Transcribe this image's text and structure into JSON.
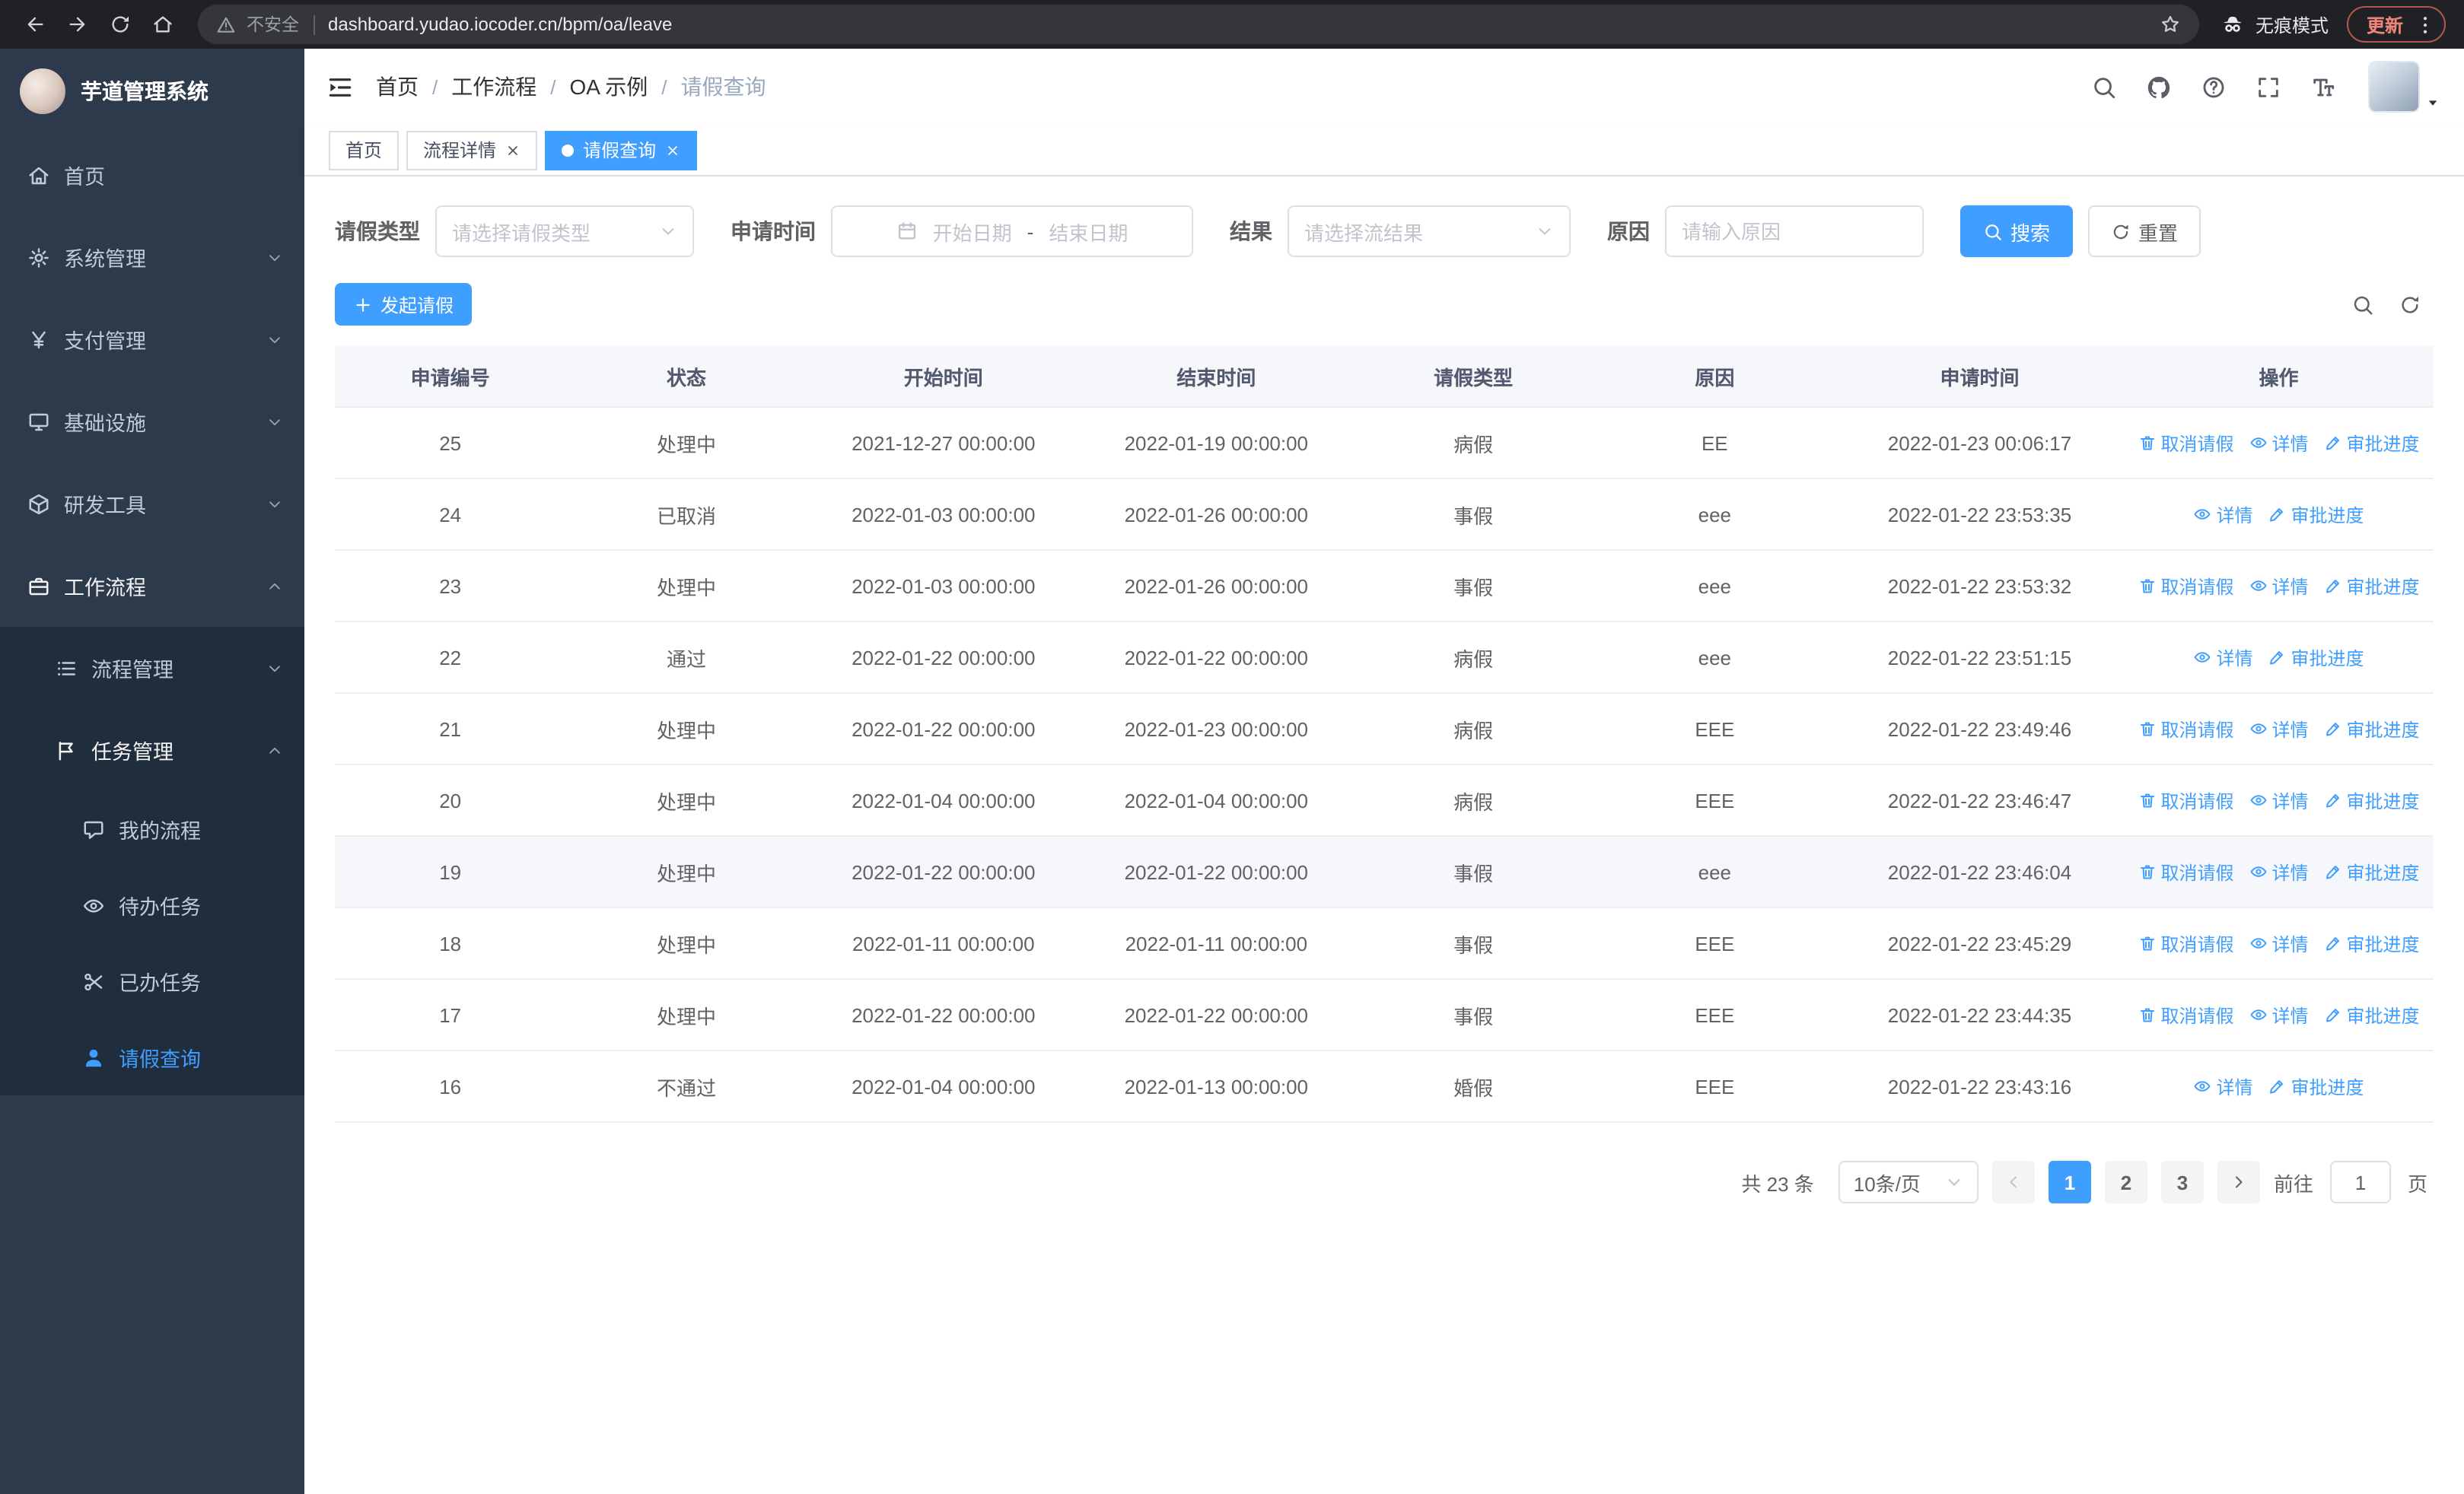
{
  "browser": {
    "security_warning": "不安全",
    "url": "dashboard.yudao.iocoder.cn/bpm/oa/leave",
    "incognito_label": "无痕模式",
    "update_button": "更新"
  },
  "sidebar": {
    "logo_title": "芋道管理系统",
    "items": [
      {
        "name": "home",
        "label": "首页",
        "icon": "home",
        "level": 1
      },
      {
        "name": "system",
        "label": "系统管理",
        "icon": "gear",
        "level": 1,
        "chevron": "down"
      },
      {
        "name": "payment",
        "label": "支付管理",
        "icon": "yen",
        "level": 1,
        "chevron": "down"
      },
      {
        "name": "infrastructure",
        "label": "基础设施",
        "icon": "infra",
        "level": 1,
        "chevron": "down"
      },
      {
        "name": "dev-tools",
        "label": "研发工具",
        "icon": "tools",
        "level": 1,
        "chevron": "down"
      },
      {
        "name": "workflow",
        "label": "工作流程",
        "icon": "workflow",
        "level": 1,
        "chevron": "up"
      },
      {
        "name": "process-mgmt",
        "label": "流程管理",
        "icon": "list",
        "level": 2,
        "chevron": "down"
      },
      {
        "name": "task-mgmt",
        "label": "任务管理",
        "icon": "task",
        "level": 2,
        "chevron": "up"
      },
      {
        "name": "my-process",
        "label": "我的流程",
        "icon": "chat",
        "level": 3
      },
      {
        "name": "todo-task",
        "label": "待办任务",
        "icon": "eye",
        "level": 3
      },
      {
        "name": "done-task",
        "label": "已办任务",
        "icon": "done",
        "level": 3
      },
      {
        "name": "leave-query",
        "label": "请假查询",
        "icon": "user",
        "level": 3,
        "active": true
      }
    ]
  },
  "header": {
    "breadcrumbs": [
      "首页",
      "工作流程",
      "OA 示例",
      "请假查询"
    ]
  },
  "tabs": [
    {
      "name": "home",
      "label": "首页",
      "closable": false,
      "active": false
    },
    {
      "name": "process-detail",
      "label": "流程详情",
      "closable": true,
      "active": false
    },
    {
      "name": "leave-query",
      "label": "请假查询",
      "closable": true,
      "active": true
    }
  ],
  "filters": {
    "leave_type": {
      "label": "请假类型",
      "placeholder": "请选择请假类型"
    },
    "apply_time": {
      "label": "申请时间",
      "start_placeholder": "开始日期",
      "separator": "-",
      "end_placeholder": "结束日期"
    },
    "result": {
      "label": "结果",
      "placeholder": "请选择流结果"
    },
    "reason": {
      "label": "原因",
      "placeholder": "请输入原因"
    },
    "search_button": "搜索",
    "reset_button": "重置"
  },
  "toolbar": {
    "create_button": "发起请假"
  },
  "table": {
    "columns": [
      "申请编号",
      "状态",
      "开始时间",
      "结束时间",
      "请假类型",
      "原因",
      "申请时间",
      "操作"
    ],
    "action_labels": {
      "cancel": "取消请假",
      "detail": "详情",
      "progress": "审批进度"
    },
    "rows": [
      {
        "id": "25",
        "status": "处理中",
        "start": "2021-12-27 00:00:00",
        "end": "2022-01-19 00:00:00",
        "type": "病假",
        "reason": "EE",
        "apply": "2022-01-23 00:06:17",
        "actions": [
          "cancel",
          "detail",
          "progress"
        ]
      },
      {
        "id": "24",
        "status": "已取消",
        "start": "2022-01-03 00:00:00",
        "end": "2022-01-26 00:00:00",
        "type": "事假",
        "reason": "eee",
        "apply": "2022-01-22 23:53:35",
        "actions": [
          "detail",
          "progress"
        ]
      },
      {
        "id": "23",
        "status": "处理中",
        "start": "2022-01-03 00:00:00",
        "end": "2022-01-26 00:00:00",
        "type": "事假",
        "reason": "eee",
        "apply": "2022-01-22 23:53:32",
        "actions": [
          "cancel",
          "detail",
          "progress"
        ]
      },
      {
        "id": "22",
        "status": "通过",
        "start": "2022-01-22 00:00:00",
        "end": "2022-01-22 00:00:00",
        "type": "病假",
        "reason": "eee",
        "apply": "2022-01-22 23:51:15",
        "actions": [
          "detail",
          "progress"
        ]
      },
      {
        "id": "21",
        "status": "处理中",
        "start": "2022-01-22 00:00:00",
        "end": "2022-01-23 00:00:00",
        "type": "病假",
        "reason": "EEE",
        "apply": "2022-01-22 23:49:46",
        "actions": [
          "cancel",
          "detail",
          "progress"
        ]
      },
      {
        "id": "20",
        "status": "处理中",
        "start": "2022-01-04 00:00:00",
        "end": "2022-01-04 00:00:00",
        "type": "病假",
        "reason": "EEE",
        "apply": "2022-01-22 23:46:47",
        "actions": [
          "cancel",
          "detail",
          "progress"
        ]
      },
      {
        "id": "19",
        "status": "处理中",
        "start": "2022-01-22 00:00:00",
        "end": "2022-01-22 00:00:00",
        "type": "事假",
        "reason": "eee",
        "apply": "2022-01-22 23:46:04",
        "actions": [
          "cancel",
          "detail",
          "progress"
        ],
        "hover": true
      },
      {
        "id": "18",
        "status": "处理中",
        "start": "2022-01-11 00:00:00",
        "end": "2022-01-11 00:00:00",
        "type": "事假",
        "reason": "EEE",
        "apply": "2022-01-22 23:45:29",
        "actions": [
          "cancel",
          "detail",
          "progress"
        ]
      },
      {
        "id": "17",
        "status": "处理中",
        "start": "2022-01-22 00:00:00",
        "end": "2022-01-22 00:00:00",
        "type": "事假",
        "reason": "EEE",
        "apply": "2022-01-22 23:44:35",
        "actions": [
          "cancel",
          "detail",
          "progress"
        ]
      },
      {
        "id": "16",
        "status": "不通过",
        "start": "2022-01-04 00:00:00",
        "end": "2022-01-13 00:00:00",
        "type": "婚假",
        "reason": "EEE",
        "apply": "2022-01-22 23:43:16",
        "actions": [
          "detail",
          "progress"
        ]
      }
    ]
  },
  "pagination": {
    "total_text": "共 23 条",
    "page_size": "10条/页",
    "pages": [
      "1",
      "2",
      "3"
    ],
    "active_page": "1",
    "goto_label": "前往",
    "goto_value": "1",
    "goto_suffix": "页"
  },
  "colors": {
    "primary": "#409eff",
    "sidebar": "#2d3a4b",
    "submenu": "#1f2d3d"
  }
}
